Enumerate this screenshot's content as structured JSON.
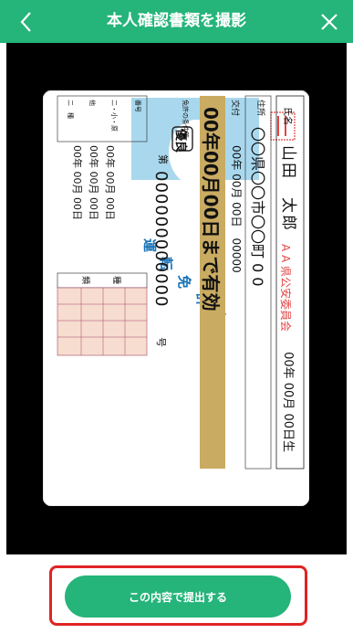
{
  "header": {
    "title": "本人確認書類を撮影",
    "back_icon": "chevron-left-icon",
    "close_icon": "close-icon"
  },
  "license": {
    "birth_date": "00年 00月 00日生",
    "name_label": "氏名",
    "name": "山田　太郎",
    "address_label": "住所",
    "address": "〇〇県〇〇市〇〇町 0 0",
    "issue_label": "交付",
    "issue_date": "00年 00月 00日　00000",
    "valid_until": "00年00月00日まで有効",
    "conditions_label": "免許の条件等",
    "excellent_mark": "優良",
    "number_prefix": "第",
    "number": "000000000000",
    "number_suffix": "号",
    "title_chars": [
      "運",
      "転",
      "免",
      "許",
      "証"
    ],
    "issuer": "A A 県公安委員会",
    "class_row1": "二・小・原",
    "class_row2": "他",
    "class_row3": "二　種",
    "dates": [
      "00年 00月 00日",
      "00年 00月 00日",
      "00年 00月 00日"
    ],
    "kind_label_1": "種",
    "kind_label_2": "類",
    "number_small_label": "番号"
  },
  "submit": {
    "label": "この内容で提出する"
  },
  "colors": {
    "brand_green": "#25b47a",
    "highlight_red": "#e02424",
    "validity_band": "#c9ab61",
    "photo_blue": "#a9d8ee",
    "title_blue": "#1a73b8"
  }
}
